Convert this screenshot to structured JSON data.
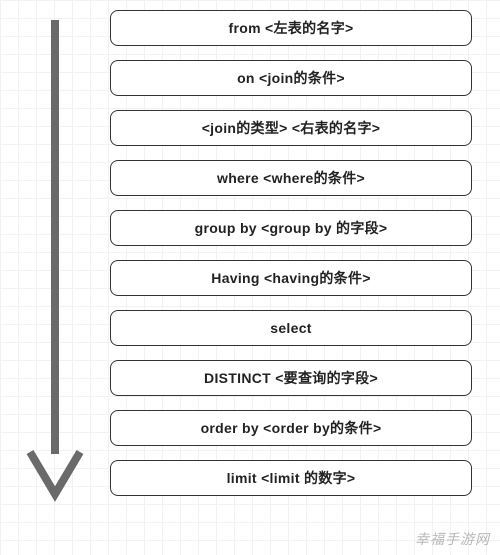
{
  "steps": [
    "from  <左表的名字>",
    "on <join的条件>",
    "<join的类型> <右表的名字>",
    "where <where的条件>",
    "group by <group by 的字段>",
    "Having <having的条件>",
    "select",
    "DISTINCT <要查询的字段>",
    "order by <order by的条件>",
    "limit <limit 的数字>"
  ],
  "watermark": "幸福手游网",
  "arrow": {
    "color": "#6a6a6a",
    "stroke": 8
  }
}
